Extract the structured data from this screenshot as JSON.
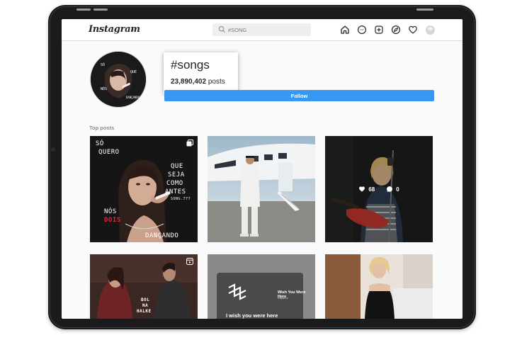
{
  "app": {
    "logo_text": "Instagram",
    "logo_chevron": "⌄"
  },
  "search": {
    "placeholder": "#SONG"
  },
  "nav": {
    "icons": [
      "home-icon",
      "messenger-icon",
      "new-post-icon",
      "explore-icon",
      "activity-heart-icon",
      "profile-avatar"
    ]
  },
  "hashtag": {
    "title": "#songs",
    "post_count": "23,890,402",
    "posts_label": "posts",
    "follow_label": "Follow"
  },
  "section": {
    "top_posts_label": "Top posts"
  },
  "posts": [
    {
      "lines_left": [
        "SÓ",
        "QUERO"
      ],
      "lines_right": [
        "QUE",
        "SEJA",
        "COMO",
        "ANTES"
      ],
      "small": "SONG.777",
      "lower": [
        "NÓS"
      ],
      "red_word": "DOIS",
      "bottom": "DANÇANDO",
      "multi": true
    },
    {
      "description": "man-standing-by-private-jet"
    },
    {
      "likes": "68",
      "comments": "0"
    },
    {
      "overlay_lines": [
        "BOL",
        "NA",
        "HALKE"
      ],
      "reel": true
    },
    {
      "song_title": "Wish You Were Here",
      "artist": "Español",
      "caption": "I wish you were here"
    },
    {
      "description": "woman-in-black-dress"
    }
  ],
  "colors": {
    "follow_blue": "#3897f0",
    "text_primary": "#262626",
    "text_secondary": "#8e8e8e",
    "doís_red": "#e0243a"
  }
}
